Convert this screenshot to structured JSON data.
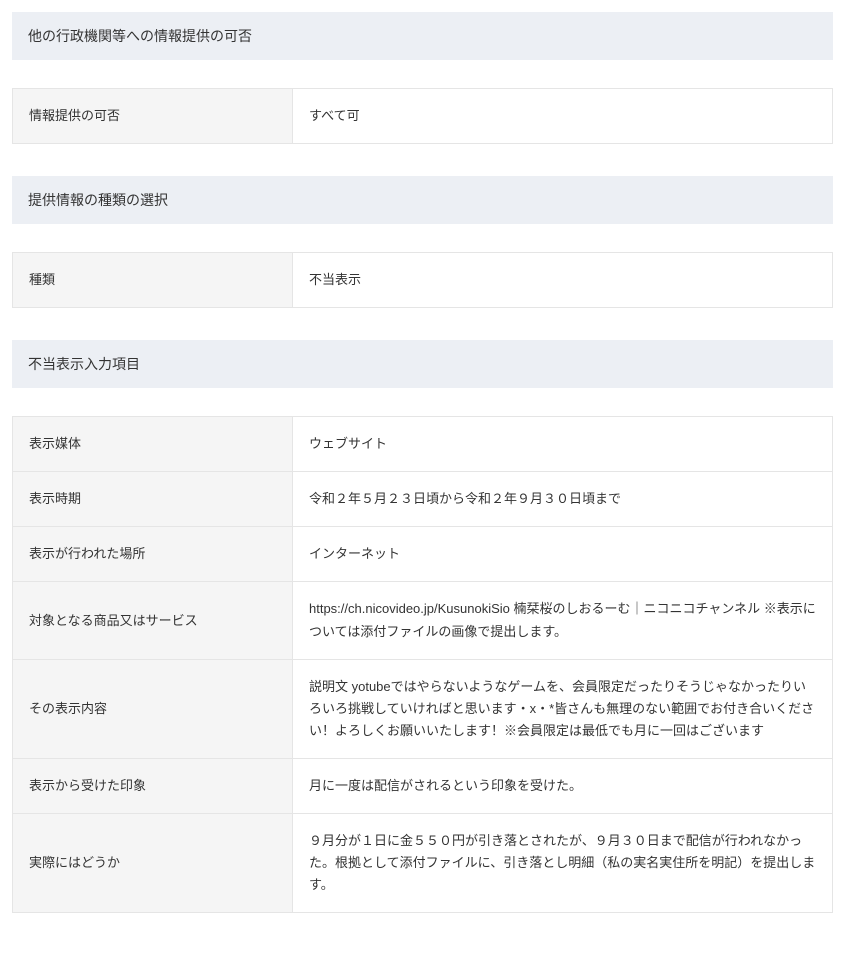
{
  "section1": {
    "header": "他の行政機関等への情報提供の可否",
    "rows": [
      {
        "label": "情報提供の可否",
        "value": "すべて可"
      }
    ]
  },
  "section2": {
    "header": "提供情報の種類の選択",
    "rows": [
      {
        "label": "種類",
        "value": "不当表示"
      }
    ]
  },
  "section3": {
    "header": "不当表示入力項目",
    "rows": [
      {
        "label": "表示媒体",
        "value": "ウェブサイト"
      },
      {
        "label": "表示時期",
        "value": "令和２年５月２３日頃から令和２年９月３０日頃まで"
      },
      {
        "label": "表示が行われた場所",
        "value": "インターネット"
      },
      {
        "label": "対象となる商品又はサービス",
        "value": "https://ch.nicovideo.jp/KusunokiSio 楠栞桜のしおるーむ｜ニコニコチャンネル ※表示については添付ファイルの画像で提出します。"
      },
      {
        "label": "その表示内容",
        "value": "説明文 yotubeではやらないようなゲームを、会員限定だったりそうじゃなかったりいろいろ挑戦していければと思います・x・*皆さんも無理のない範囲でお付き合いください！よろしくお願いいたします！※会員限定は最低でも月に一回はございます"
      },
      {
        "label": "表示から受けた印象",
        "value": "月に一度は配信がされるという印象を受けた。"
      },
      {
        "label": "実際にはどうか",
        "value": "９月分が１日に金５５０円が引き落とされたが、９月３０日まで配信が行われなかった。根拠として添付ファイルに、引き落とし明細（私の実名実住所を明記）を提出します。"
      }
    ]
  }
}
